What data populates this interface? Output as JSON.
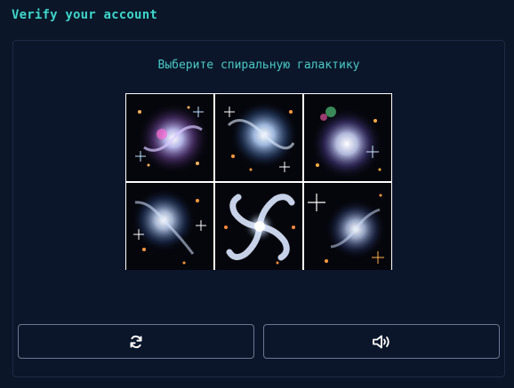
{
  "header": {
    "title": "Verify your account"
  },
  "captcha": {
    "prompt": "Выберите спиральную галактику",
    "tiles": [
      {
        "icon": "galaxy-image-1"
      },
      {
        "icon": "galaxy-image-2"
      },
      {
        "icon": "galaxy-image-3"
      },
      {
        "icon": "galaxy-image-4"
      },
      {
        "icon": "spiral-galaxy-image"
      },
      {
        "icon": "galaxy-image-6"
      }
    ],
    "buttons": {
      "refresh_icon": "refresh-icon",
      "audio_icon": "speaker-icon"
    }
  },
  "colors": {
    "background": "#0c1629",
    "accent": "#3cd6c8",
    "border": "#6b7891"
  }
}
